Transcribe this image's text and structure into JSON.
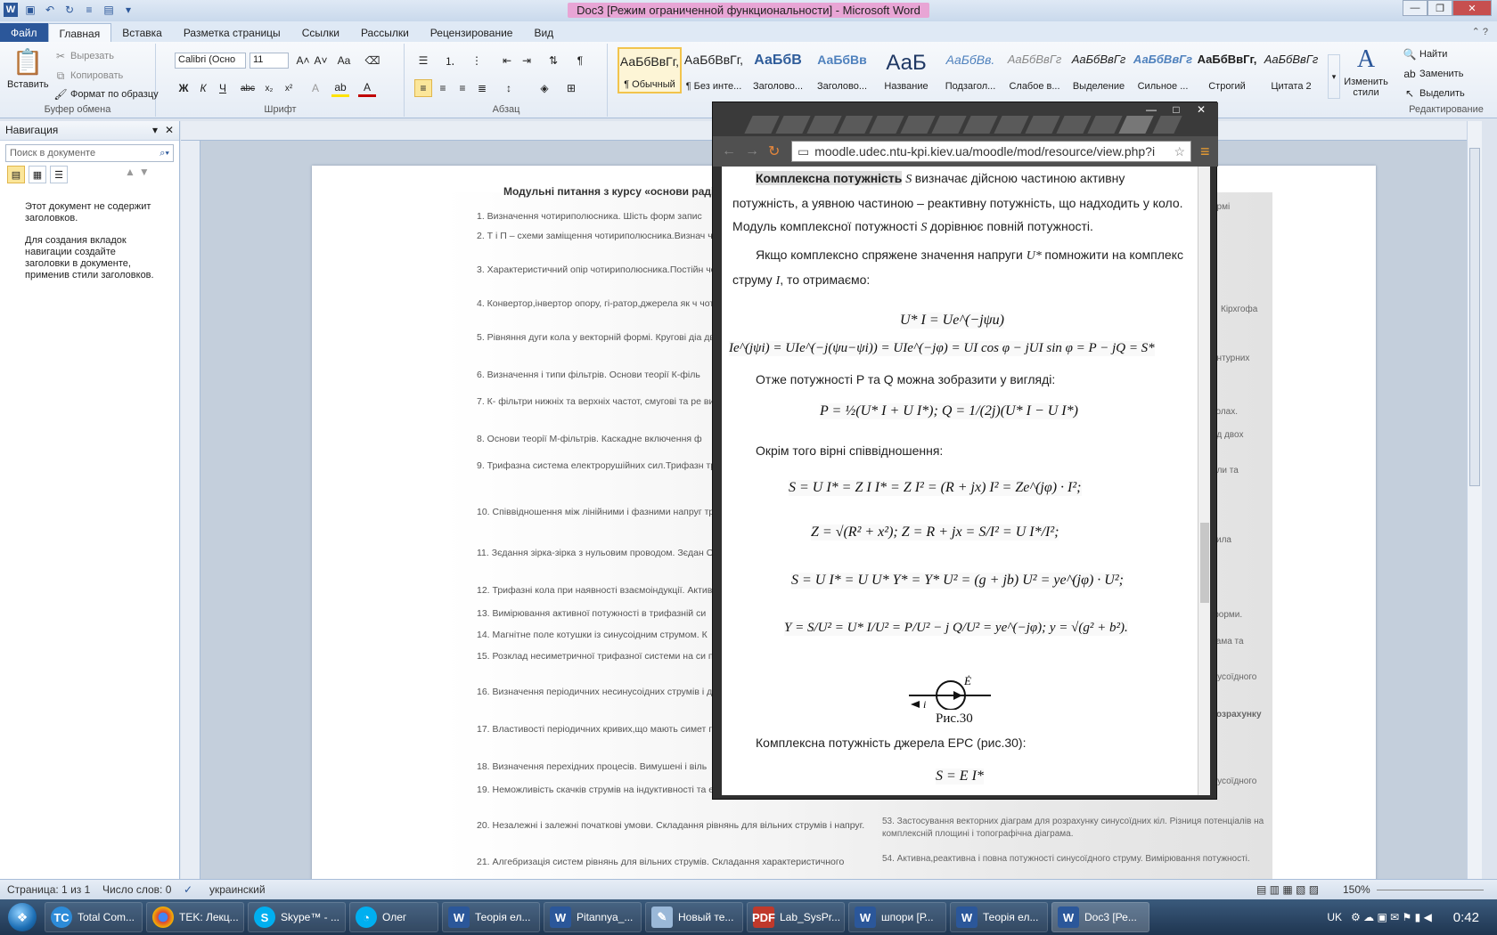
{
  "titlebar": {
    "title": "Doc3 [Режим ограниченной функциональности]  -  Microsoft Word"
  },
  "tabs": [
    {
      "label": "Файл"
    },
    {
      "label": "Главная"
    },
    {
      "label": "Вставка"
    },
    {
      "label": "Разметка страницы"
    },
    {
      "label": "Ссылки"
    },
    {
      "label": "Рассылки"
    },
    {
      "label": "Рецензирование"
    },
    {
      "label": "Вид"
    }
  ],
  "ribbon": {
    "clipboard": {
      "paste": "Вставить",
      "cut": "Вырезать",
      "copy": "Копировать",
      "format_painter": "Формат по образцу",
      "group": "Буфер обмена"
    },
    "font": {
      "name": "Calibri (Осно",
      "size": "11",
      "group": "Шрифт"
    },
    "paragraph": {
      "group": "Абзац"
    },
    "styles": [
      {
        "preview": "АаБбВвГг,",
        "name": "¶ Обычный"
      },
      {
        "preview": "АаБбВвГг,",
        "name": "¶ Без инте..."
      },
      {
        "preview": "АаБбВ",
        "name": "Заголово..."
      },
      {
        "preview": "АаБбВв",
        "name": "Заголово..."
      },
      {
        "preview": "АаБ",
        "name": "Название"
      },
      {
        "preview": "АаБбВв.",
        "name": "Подзагол..."
      },
      {
        "preview": "АаБбВвГг",
        "name": "Слабое в..."
      },
      {
        "preview": "АаБбВвГг",
        "name": "Выделение"
      },
      {
        "preview": "АаБбВвГг",
        "name": "Сильное ..."
      },
      {
        "preview": "АаБбВвГг,",
        "name": "Строгий"
      },
      {
        "preview": "АаБбВвГг",
        "name": "Цитата 2"
      }
    ],
    "change_styles": "Изменить стили",
    "editing": {
      "find": "Найти",
      "replace": "Заменить",
      "select": "Выделить",
      "group": "Редактирование"
    }
  },
  "nav": {
    "title": "Навигация",
    "search_placeholder": "Поиск в документе",
    "msg1": "Этот документ не содержит заголовков.",
    "msg2": "Для создания вкладок навигации создайте заголовки в документе, применив стили заголовков."
  },
  "document": {
    "title": "Модульні питання з курсу «основи раді",
    "items": [
      "1.  Визначення чотириполюсника. Шість  форм запис",
      "2.  Т і П – схеми заміщення чотириполюсника.Визнач чотириполюсника.",
      "3.  Характеристичний опір чотириполюсника.Постійн чотириполюсника записані через гіперболічні фу",
      "4.  Конвертор,інвертор опору, гі-ратор,джерела як ч чотириполюсника.",
      "5.  Рівняння дуги кола у векторній формі. Кругові діа двополюсника та чотириполюсника.",
      "6.  Визначення і типи фільтрів. Основи теорії  К-філь",
      "7.  К- фільтри нижніх та верхніх частот, смугові та ре визначення  К-фільтра.",
      "8.  Основи теорії  М-фільтрів. Каскадне включення ф",
      "9.  Трифазна система електрорушійних сил.Трифазн трифазних кіл.",
      "10. Співвідношення між лінійними і фазними напруг трифазних кіл.",
      "11. Зєдання зірка-зірка з нульовим проводом. Зєдан Оператор ẟ в трифазній системі.",
      "12. Трифазні кола при наявності взаємоіндукції. Актив",
      "13.  Вимірювання активної потужності в трифазній си",
      "14. Магнітне поле котушки із синусоідним струмом. К",
      "15. Розклад  несиметричної  трифазної системи на си послідовності фаз.",
      "16. Визначення періодичних несинусоідних струмів і допомогою рядів Фур'є.",
      "17. Властивості періодичних кривих,що мають симет геометричнo правильної і неправильної форми.",
      "18. Визначення перехідних процесів. Вимушені і віль",
      "19. Неможливість скачків струмів на індуктивності та е другий закони комутації. Початкові значення величин.",
      "20. Незалежні і залежні початкові умови. Складання рівнянь для вільних струмів і напруг.",
      "21. Алгебризація  систем рівнянь для вільних струмів. Складання характеристичного"
    ],
    "right_snips": [
      "ормі",
      "Кірхгофа",
      "онтурних",
      "колах.",
      "од двох",
      "или та",
      "сила",
      "ті форми.",
      "аграма та",
      "синусоїдного",
      "и розрахунку",
      "синусоїдного",
      "53. Застосування векторних діаграм для розрахунку синусоїдних кіл. Різниця потенціалів на комплексній площині і топографічна діаграма.",
      "54. Активна,реактивна і повна потужності синусоїдного струму. Вимірювання потужності."
    ]
  },
  "browser": {
    "url": "moodle.udec.ntu-kpi.kiev.ua/moodle/mod/resource/view.php?i",
    "highlight": "Комплексна потужність",
    "p1a": "визначає дійсною частиною активну",
    "p1b": "потужність, а уявною частиною – реактивну потужність, що надходить у коло. Модуль комплексної потужності",
    "p1c": "дорівнює повній потужності.",
    "p2a": "Якщо комплексно спряжене значення напруги",
    "p2b": "помножити на комплекс струму",
    "p2c": ", то отримаємо:",
    "f1": "U* I = Ue^(−jψu)",
    "f2": "Ie^(jψi) = UIe^(−j(ψu−ψi)) = UIe^(−jφ) = UI cos φ − jUI sin φ = P − jQ = S*",
    "p3": "Отже потужності P та Q можна зобразити у вигляді:",
    "f3": "P = ½(U* I + U I*);        Q = 1/(2j)(U* I − U I*)",
    "p4": "Окрім того вірні співвідношення:",
    "f4": "S = U I* = Z I I* = Z I² = (R + jx) I² = Ze^(jφ) · I²;",
    "f5": "Z = √(R² + x²);     Z = R + jx = S/I² = U I*/I²;",
    "f6": "S = U I* = U U* Y* = Y* U² = (g + jb) U² = ye^(jφ) · U²;",
    "f7": "Y = S/U² = U* I/U² = P/U² − j Q/U² = ye^(−jφ);    y = √(g² + b²).",
    "fig_caption": "Рис.30",
    "fig_e": "Ė",
    "fig_i": "i",
    "p5": "Комплексна потужність джерела ЕРС (рис.30):",
    "f8": "S = E I*"
  },
  "status": {
    "page": "Страница: 1 из 1",
    "words": "Число слов: 0",
    "lang": "украинский",
    "zoom": "150%"
  },
  "taskbar": [
    {
      "label": "Total Com..."
    },
    {
      "label": "TEK: Лекц..."
    },
    {
      "label": "Skype™ - ..."
    },
    {
      "label": "Олег"
    },
    {
      "label": "Теорія ел..."
    },
    {
      "label": "Pitannya_..."
    },
    {
      "label": "Новый те..."
    },
    {
      "label": "Lab_SysPr..."
    },
    {
      "label": "шпори [Р..."
    },
    {
      "label": "Теорія ел..."
    },
    {
      "label": "Doc3 [Ре..."
    }
  ],
  "tray": {
    "lang": "UK",
    "clock": "0:42"
  },
  "colors": {
    "word_blue": "#2b579a",
    "file_tab": "#2b579a",
    "title_highlight": "#e8a5d5"
  }
}
